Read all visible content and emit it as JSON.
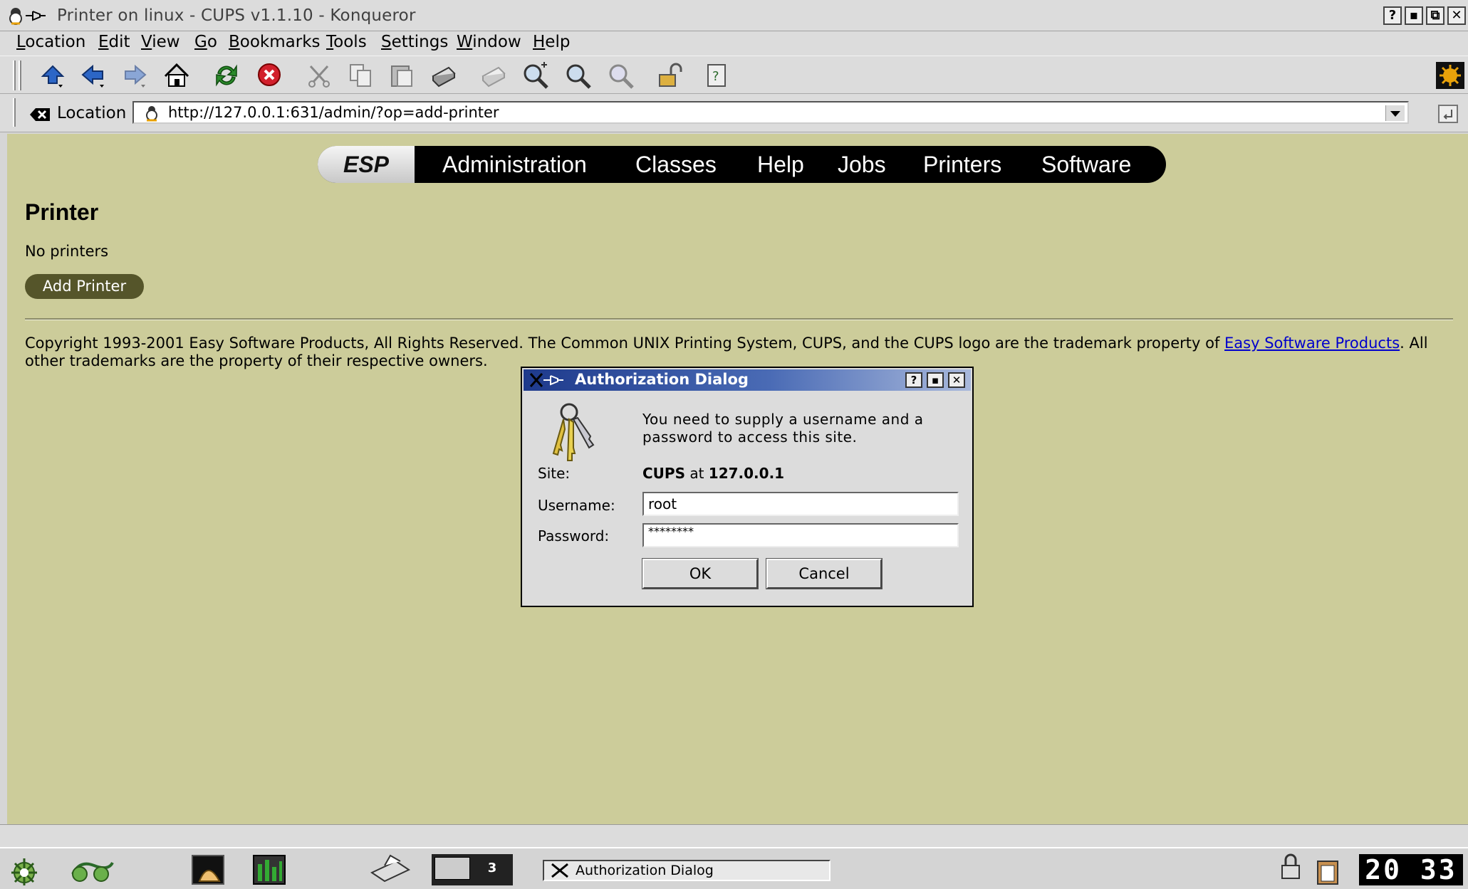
{
  "window": {
    "title": "Printer on linux - CUPS v1.1.10 - Konqueror",
    "buttons": [
      "?",
      "▪",
      "⧉",
      "✕"
    ]
  },
  "menubar": {
    "items": [
      "Location",
      "Edit",
      "View",
      "Go",
      "Bookmarks",
      "Tools",
      "Settings",
      "Window",
      "Help"
    ]
  },
  "toolbar": {
    "icons": [
      "up-icon",
      "back-icon",
      "forward-icon",
      "home-icon",
      "reload-icon",
      "stop-icon",
      "cut-icon",
      "copy-icon",
      "paste-icon",
      "print-icon",
      "print-frame-icon",
      "zoom-in-icon",
      "zoom-icon",
      "zoom-out-icon",
      "security-icon",
      "help-page-icon"
    ]
  },
  "location": {
    "label": "Location",
    "url": "http://127.0.0.1:631/admin/?op=add-printer"
  },
  "page": {
    "nav": {
      "brand": "ESP",
      "items": [
        "Administration",
        "Classes",
        "Help",
        "Jobs",
        "Printers",
        "Software"
      ]
    },
    "heading": "Printer",
    "status": "No printers",
    "add_button": "Add Printer",
    "copyright_prefix": "Copyright 1993-2001 Easy Software Products, All Rights Reserved. The Common UNIX Printing System, CUPS, and the CUPS logo are the trademark property of ",
    "copyright_link": "Easy Software Products",
    "copyright_suffix": ". All other trademarks are the property of their respective owners."
  },
  "dialog": {
    "title": "Authorization Dialog",
    "message": "You need to supply a username and a password to access this site.",
    "site_label": "Site:",
    "site_name": "CUPS",
    "site_at": " at ",
    "site_host": "127.0.0.1",
    "username_label": "Username:",
    "username_value": "root",
    "password_label": "Password:",
    "password_value": "********",
    "ok_label": "OK",
    "cancel_label": "Cancel"
  },
  "taskbar": {
    "active_task": "Authorization Dialog",
    "desktop_number": "3",
    "clock": "20 33"
  },
  "colors": {
    "page_bg": "#cccc9a",
    "nav_bg": "#000000",
    "add_button_bg": "#55552a",
    "dialog_title_bg": "#1e3a8c",
    "link": "#0000cc"
  }
}
